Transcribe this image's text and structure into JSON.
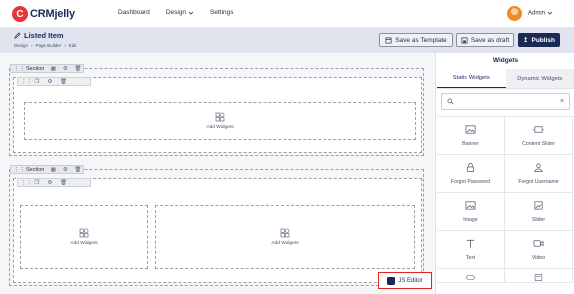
{
  "brand": {
    "initial": "C",
    "name_part1": "CRM",
    "name_part2": "jelly"
  },
  "nav": {
    "items": [
      {
        "label": "Dashboard"
      },
      {
        "label": "Design",
        "caret": "chevron-down-icon"
      },
      {
        "label": "Settings"
      }
    ],
    "user": {
      "label": "Admin"
    }
  },
  "header": {
    "title": "Listed Item",
    "breadcrumb": [
      "Design",
      "Page Builder",
      "Edit"
    ],
    "buttons": {
      "save_template": "Save as Template",
      "save_draft": "Save as draft",
      "publish": "Publish"
    }
  },
  "canvas": {
    "section_label": "Section",
    "add_widgets_label": "Add Widgets",
    "js_editor_label": "JS Editor"
  },
  "panel": {
    "title": "Widgets",
    "tabs": [
      {
        "label": "Static Widgets",
        "active": true
      },
      {
        "label": "Dynamic Widgets",
        "active": false
      }
    ],
    "search": {
      "placeholder": ""
    },
    "widgets": [
      {
        "label": "Banner",
        "icon": "image-icon"
      },
      {
        "label": "Content Slider",
        "icon": "slider-icon"
      },
      {
        "label": "Forgot Password",
        "icon": "lock-icon"
      },
      {
        "label": "Forgot Username",
        "icon": "user-icon"
      },
      {
        "label": "Image",
        "icon": "image-icon"
      },
      {
        "label": "Slider",
        "icon": "slider-icon"
      },
      {
        "label": "Text",
        "icon": "text-icon"
      },
      {
        "label": "Video",
        "icon": "video-icon"
      }
    ]
  },
  "colors": {
    "accent": "#1b2a55",
    "highlight": "#e02424",
    "brand_red": "#e8353a"
  }
}
